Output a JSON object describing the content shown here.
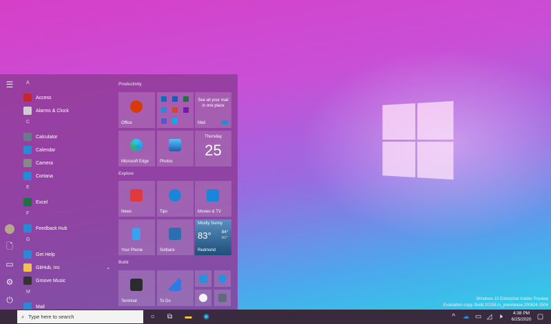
{
  "start_menu": {
    "rail": {
      "menu": "hamburger-icon",
      "items": [
        "avatar",
        "document-icon",
        "pictures-icon",
        "settings-icon",
        "power-icon"
      ]
    },
    "apps": [
      {
        "letter": "A"
      },
      {
        "name": "Access",
        "color": "#c4262e"
      },
      {
        "name": "Alarms & Clock",
        "color": "#cfcfcf"
      },
      {
        "letter": "C"
      },
      {
        "name": "Calculator",
        "color": "#6a7a8a"
      },
      {
        "name": "Calendar",
        "color": "#2b88d8"
      },
      {
        "name": "Camera",
        "color": "#888"
      },
      {
        "name": "Cortana",
        "color": "#2b88d8"
      },
      {
        "letter": "E"
      },
      {
        "name": "Excel",
        "color": "#1e7145"
      },
      {
        "letter": "F"
      },
      {
        "name": "Feedback Hub",
        "color": "#2b88d8"
      },
      {
        "letter": "G"
      },
      {
        "name": "Get Help",
        "color": "#2b88d8"
      },
      {
        "name": "GitHub, Inc",
        "color": "#f2c14e",
        "folder": true
      },
      {
        "name": "Groove Music",
        "color": "#333"
      },
      {
        "letter": "M"
      },
      {
        "name": "Mail",
        "color": "#2b88d8"
      }
    ],
    "groups": {
      "productivity": "Productivity",
      "explore": "Explore",
      "build": "Build"
    },
    "tiles": {
      "office": "Office",
      "mail": "Mail",
      "mail_text": "See all your mail in one place",
      "edge": "Microsoft Edge",
      "photos": "Photos",
      "calendar_day": "Thursday",
      "calendar_date": "25",
      "news": "News",
      "tips": "Tips",
      "movies": "Movies & TV",
      "phone": "Your Phone",
      "solitaire": "Solitaire",
      "weather": {
        "condition": "Mostly Sunny",
        "temp": "83°",
        "high": "84°",
        "low": "60°",
        "city": "Redmond"
      },
      "terminal": "Terminal",
      "todo": "To Do"
    }
  },
  "taskbar": {
    "search_placeholder": "Type here to search",
    "time": "4:38 PM",
    "date": "6/25/2020"
  },
  "watermark": {
    "line1": "Windows 10 Enterprise Insider Preview",
    "line2": "Evaluation copy. Build 20158.rs_prerelease.200624-1504"
  }
}
